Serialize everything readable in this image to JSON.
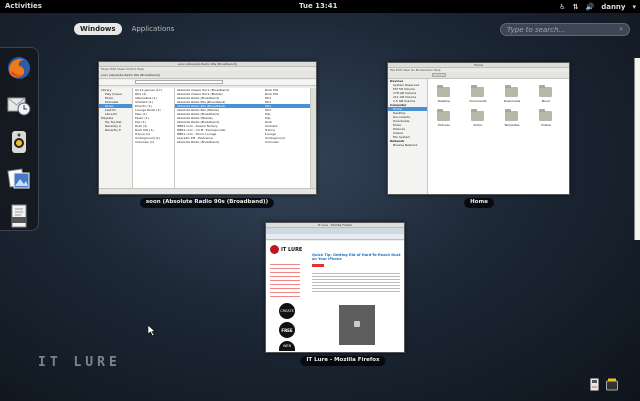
{
  "topbar": {
    "activities": "Activities",
    "clock": "Tue 13:41",
    "user": "danny",
    "icons": [
      "accessibility-icon",
      "network-icon",
      "volume-icon",
      "user-menu-chevron-icon"
    ]
  },
  "overview": {
    "tabs": [
      {
        "label": "Windows",
        "active": true
      },
      {
        "label": "Applications",
        "active": false
      }
    ],
    "search_placeholder": "Type to search..."
  },
  "dash": {
    "items": [
      "firefox-icon",
      "mail-clock-icon",
      "sound-player-icon",
      "image-viewer-icon",
      "document-icon"
    ]
  },
  "windows": [
    {
      "title": "soon (Absolute Radio 90s (Broadband))",
      "app": "audio-player",
      "header": "soon (Absolute Radio 90s (Broadband))",
      "sidebar": [
        "Library",
        "Play Queue",
        "Music",
        "Podcasts",
        "Radio",
        "Last.fm",
        "Libre.fm",
        "Playlists",
        "My Top Rat",
        "Recently A",
        "Recently P"
      ],
      "genres": [
        "All 12 genres (17)",
        "80's (2)",
        "Alternative (1)",
        "Ambient (1)",
        "Eclectic (1)",
        "Lounge Radio (1)",
        "Misc (1)",
        "Music (1)",
        "Pop (1)",
        "Rock (2)",
        "Rock Mix (1)",
        "Trance (1)",
        "Underground (1)",
        "Unknown (1)"
      ],
      "stations": [
        "Absolute Classic Rock (Broadband)",
        "Absolute Classic Rock (Mobile)",
        "Absolute Radio (Broadband)",
        "Absolute Radio 80s (Broadband)",
        "Absolute Radio 90s (Broadband)",
        "Absolute Radio 90s (Mobile)",
        "Absolute Radio (Broadband)",
        "Absolute Radio (Mobile)",
        "Absolute Radio (Broadband)",
        "HBR1.com - Dream Factory",
        "HBR1.com - I.D.M. Tranceponder",
        "HBR1.com - Tronic Lounge",
        "psyradio FM - Psytrance",
        "Absolute Radio (Broadband)"
      ],
      "genre_col": [
        "Rock Mix",
        "Rock Mix",
        "80's",
        "80's",
        "90's",
        "90's",
        "Pop",
        "Pop",
        "Rock",
        "Ambient",
        "Trance",
        "Lounge",
        "Underground",
        "Unknown"
      ]
    },
    {
      "title": "Home",
      "app": "file-manager",
      "sidebar": [
        "Devices",
        "System Reserved",
        "FAT 58 Volume",
        "178 GB Volume",
        "211 GB Volume",
        "2.5 GB Volume",
        "Computer",
        "Home",
        "Desktop",
        "Documents",
        "Downloads",
        "Music",
        "Pictures",
        "Videos",
        "File System",
        "Network",
        "Browse Network"
      ],
      "folders": [
        "Desktop",
        "Documents",
        "Downloads",
        "Music",
        "Pictures",
        "Public",
        "Templates",
        "Videos"
      ]
    },
    {
      "title": "IT Lure - Mozilla Firefox",
      "app": "firefox",
      "site_name": "IT LURE",
      "post_title": "Quick Tip: Getting Rid of Hard-To-Reach Dust on Your iPhone",
      "sidebar_badges": [
        "CREATE",
        "FREE",
        "WEB"
      ]
    }
  ],
  "watermark": "IT LURE",
  "bottom_tray": [
    "removable-drive-icon",
    "status-icon"
  ]
}
